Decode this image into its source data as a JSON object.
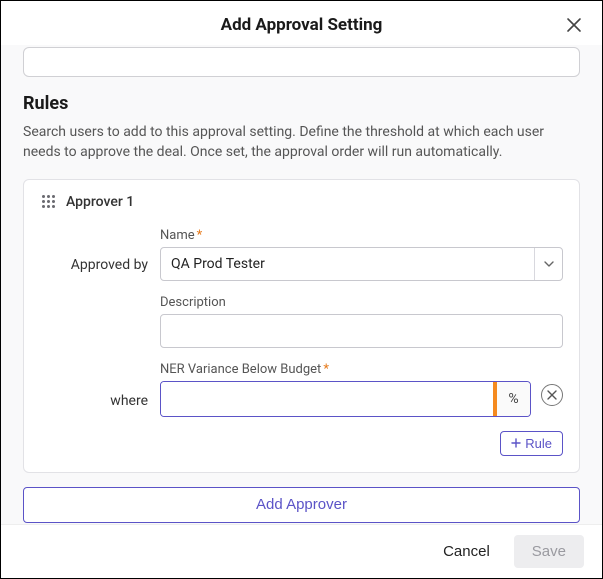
{
  "header": {
    "title": "Add Approval Setting"
  },
  "rules": {
    "title": "Rules",
    "description": "Search users to add to this approval setting. Define the threshold at which each user needs to approve the deal. Once set, the approval order will run automatically."
  },
  "approver": {
    "title": "Approver 1",
    "approved_by_label": "Approved by",
    "name_label": "Name",
    "name_value": "QA Prod Tester",
    "description_label": "Description",
    "description_value": "",
    "where_label": "where",
    "rule_field_label": "NER Variance Below Budget",
    "rule_value": "",
    "rule_unit": "%",
    "add_rule_label": "Rule"
  },
  "actions": {
    "add_approver": "Add Approver",
    "cancel": "Cancel",
    "save": "Save"
  }
}
